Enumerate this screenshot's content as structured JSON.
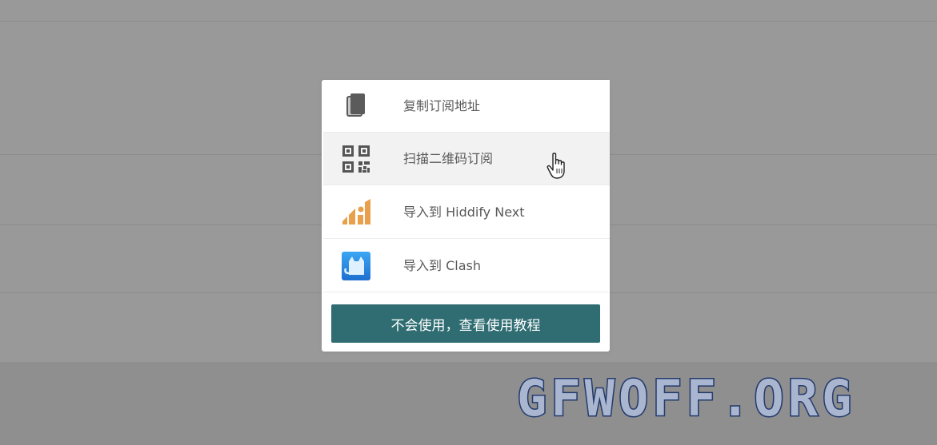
{
  "modal": {
    "items": [
      {
        "label": "复制订阅地址",
        "icon": "copy-icon"
      },
      {
        "label": "扫描二维码订阅",
        "icon": "qr-code-icon"
      },
      {
        "label": "导入到 Hiddify Next",
        "icon": "hiddify-logo-icon"
      },
      {
        "label": "导入到 Clash",
        "icon": "clash-cat-icon"
      }
    ],
    "hovered_item": "扫描二维码订阅",
    "tutorial_button": "不会使用，查看使用教程"
  },
  "watermark": "GFWOFF.ORG",
  "colors": {
    "overlay": "#999999",
    "button": "#2f6d72",
    "hiddify_orange": "#e8a04a",
    "clash_blue": "#2e8fe5",
    "watermark_outline": "#233a6c"
  }
}
